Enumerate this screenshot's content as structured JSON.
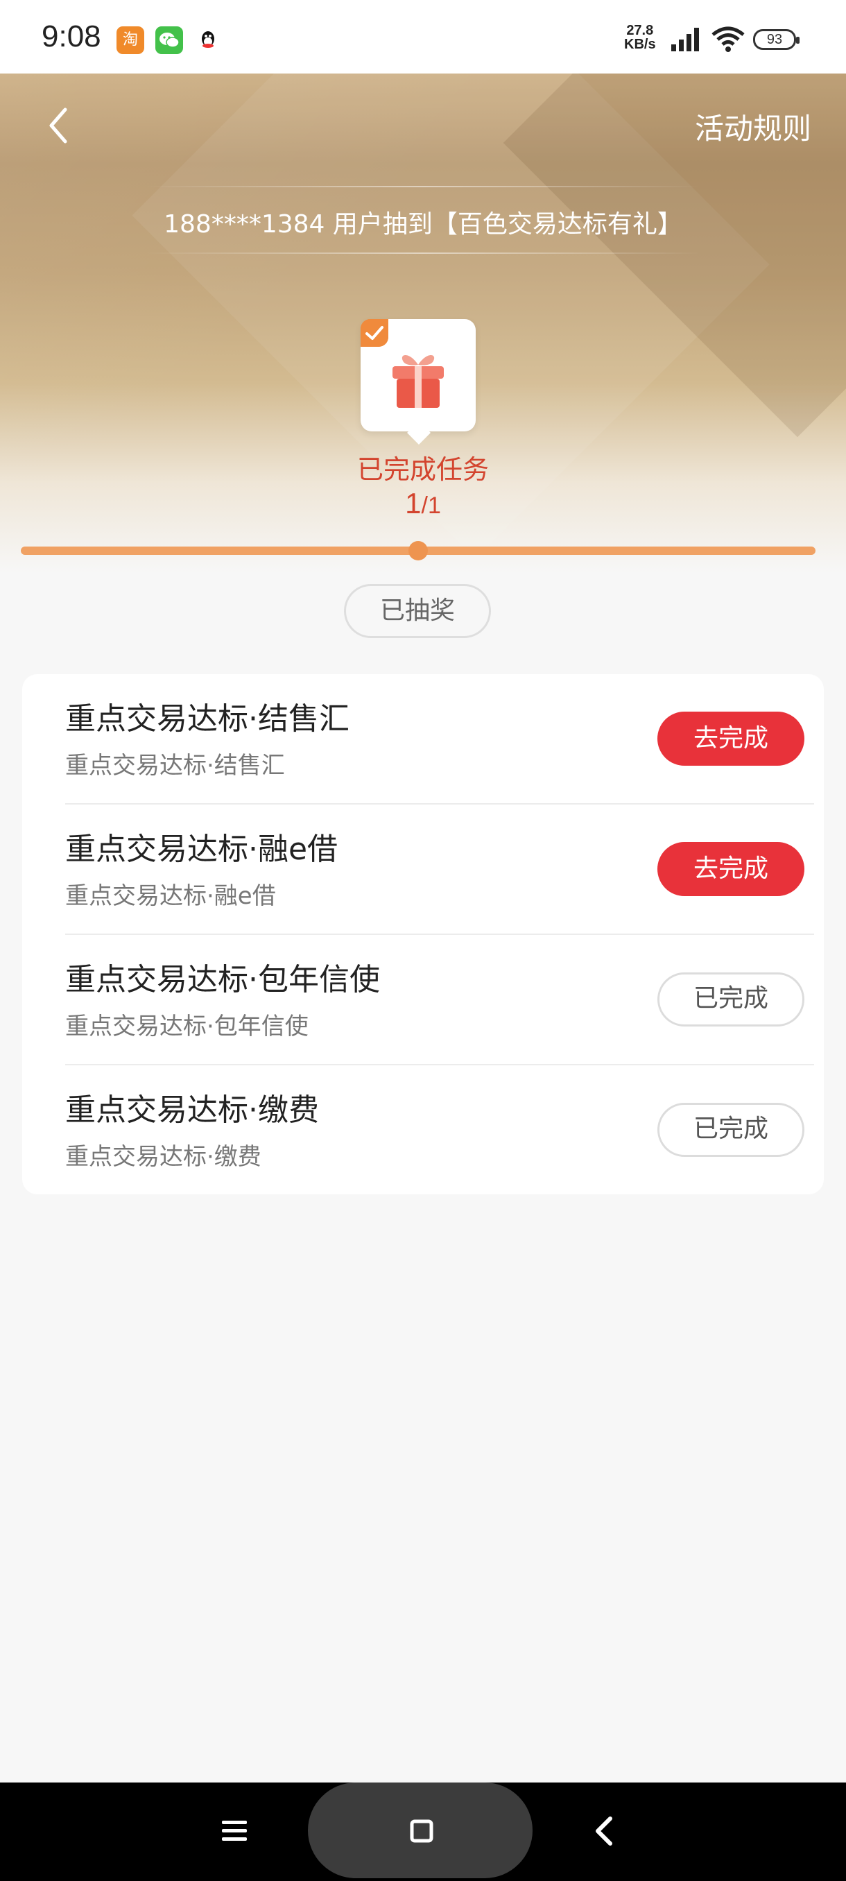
{
  "status_bar": {
    "time": "9:08",
    "apps": [
      {
        "name": "taobao-app-icon",
        "glyph": "淘"
      },
      {
        "name": "wechat-app-icon",
        "glyph": "◉"
      },
      {
        "name": "qq-app-icon",
        "glyph": "●"
      }
    ],
    "net_speed_value": "27.8",
    "net_speed_unit": "KB/s",
    "battery": "93"
  },
  "header": {
    "rules_label": "活动规则",
    "ticker": "188****1384 用户抽到【百色交易达标有礼】"
  },
  "progress": {
    "task_done_label": "已完成任务",
    "current": "1",
    "total": "/1",
    "fraction": 1.0,
    "drawn_button_label": "已抽奖"
  },
  "tasks": [
    {
      "title": "重点交易达标·结售汇",
      "subtitle": "重点交易达标·结售汇",
      "button": "去完成",
      "state": "todo"
    },
    {
      "title": "重点交易达标·融e借",
      "subtitle": "重点交易达标·融e借",
      "button": "去完成",
      "state": "todo"
    },
    {
      "title": "重点交易达标·包年信使",
      "subtitle": "重点交易达标·包年信使",
      "button": "已完成",
      "state": "done"
    },
    {
      "title": "重点交易达标·缴费",
      "subtitle": "重点交易达标·缴费",
      "button": "已完成",
      "state": "done"
    }
  ],
  "colors": {
    "accent_red": "#e8323a",
    "progress_orange": "#f0a163",
    "task_done_text": "#d3442e"
  }
}
